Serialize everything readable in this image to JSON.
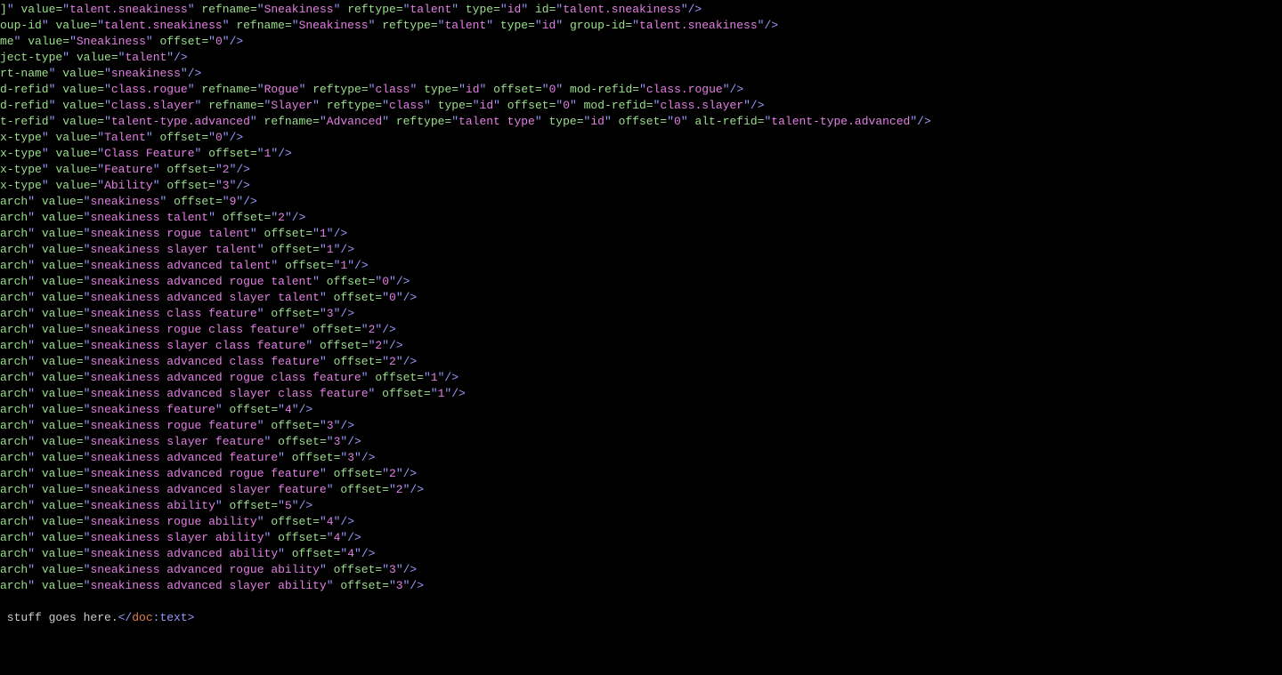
{
  "lines": [
    {
      "type": "xml",
      "pre": "",
      "attrs": [
        [
          "",
          "]",
          "",
          "talent.sneakiness"
        ],
        [
          "refname",
          "Sneakiness"
        ],
        [
          "reftype",
          "talent"
        ],
        [
          "type",
          "id"
        ],
        [
          "id",
          "talent.sneakiness"
        ]
      ]
    },
    {
      "type": "xml",
      "pre": "oup-id",
      "attrs": [
        [
          "value",
          "talent.sneakiness"
        ],
        [
          "refname",
          "Sneakiness"
        ],
        [
          "reftype",
          "talent"
        ],
        [
          "type",
          "id"
        ],
        [
          "group-id",
          "talent.sneakiness"
        ]
      ]
    },
    {
      "type": "xml",
      "pre": "me",
      "attrs": [
        [
          "value",
          "Sneakiness"
        ],
        [
          "offset",
          "0"
        ]
      ]
    },
    {
      "type": "xml",
      "pre": "ject-type",
      "attrs": [
        [
          "value",
          "talent"
        ]
      ]
    },
    {
      "type": "xml",
      "pre": "rt-name",
      "attrs": [
        [
          "value",
          "sneakiness"
        ]
      ]
    },
    {
      "type": "xml",
      "pre": "d-refid",
      "attrs": [
        [
          "value",
          "class.rogue"
        ],
        [
          "refname",
          "Rogue"
        ],
        [
          "reftype",
          "class"
        ],
        [
          "type",
          "id"
        ],
        [
          "offset",
          "0"
        ],
        [
          "mod-refid",
          "class.rogue"
        ]
      ]
    },
    {
      "type": "xml",
      "pre": "d-refid",
      "attrs": [
        [
          "value",
          "class.slayer"
        ],
        [
          "refname",
          "Slayer"
        ],
        [
          "reftype",
          "class"
        ],
        [
          "type",
          "id"
        ],
        [
          "offset",
          "0"
        ],
        [
          "mod-refid",
          "class.slayer"
        ]
      ]
    },
    {
      "type": "xml",
      "pre": "t-refid",
      "attrs": [
        [
          "value",
          "talent-type.advanced"
        ],
        [
          "refname",
          "Advanced"
        ],
        [
          "reftype",
          "talent type"
        ],
        [
          "type",
          "id"
        ],
        [
          "offset",
          "0"
        ],
        [
          "alt-refid",
          "talent-type.advanced"
        ]
      ]
    },
    {
      "type": "xml",
      "pre": "x-type",
      "attrs": [
        [
          "value",
          "Talent"
        ],
        [
          "offset",
          "0"
        ]
      ]
    },
    {
      "type": "xml",
      "pre": "x-type",
      "attrs": [
        [
          "value",
          "Class Feature"
        ],
        [
          "offset",
          "1"
        ]
      ]
    },
    {
      "type": "xml",
      "pre": "x-type",
      "attrs": [
        [
          "value",
          "Feature"
        ],
        [
          "offset",
          "2"
        ]
      ]
    },
    {
      "type": "xml",
      "pre": "x-type",
      "attrs": [
        [
          "value",
          "Ability"
        ],
        [
          "offset",
          "3"
        ]
      ]
    },
    {
      "type": "xml",
      "pre": "arch",
      "attrs": [
        [
          "value",
          "sneakiness"
        ],
        [
          "offset",
          "9"
        ]
      ]
    },
    {
      "type": "xml",
      "pre": "arch",
      "attrs": [
        [
          "value",
          "sneakiness talent"
        ],
        [
          "offset",
          "2"
        ]
      ]
    },
    {
      "type": "xml",
      "pre": "arch",
      "attrs": [
        [
          "value",
          "sneakiness rogue talent"
        ],
        [
          "offset",
          "1"
        ]
      ]
    },
    {
      "type": "xml",
      "pre": "arch",
      "attrs": [
        [
          "value",
          "sneakiness slayer talent"
        ],
        [
          "offset",
          "1"
        ]
      ]
    },
    {
      "type": "xml",
      "pre": "arch",
      "attrs": [
        [
          "value",
          "sneakiness advanced talent"
        ],
        [
          "offset",
          "1"
        ]
      ]
    },
    {
      "type": "xml",
      "pre": "arch",
      "attrs": [
        [
          "value",
          "sneakiness advanced rogue talent"
        ],
        [
          "offset",
          "0"
        ]
      ]
    },
    {
      "type": "xml",
      "pre": "arch",
      "attrs": [
        [
          "value",
          "sneakiness advanced slayer talent"
        ],
        [
          "offset",
          "0"
        ]
      ]
    },
    {
      "type": "xml",
      "pre": "arch",
      "attrs": [
        [
          "value",
          "sneakiness class feature"
        ],
        [
          "offset",
          "3"
        ]
      ]
    },
    {
      "type": "xml",
      "pre": "arch",
      "attrs": [
        [
          "value",
          "sneakiness rogue class feature"
        ],
        [
          "offset",
          "2"
        ]
      ]
    },
    {
      "type": "xml",
      "pre": "arch",
      "attrs": [
        [
          "value",
          "sneakiness slayer class feature"
        ],
        [
          "offset",
          "2"
        ]
      ]
    },
    {
      "type": "xml",
      "pre": "arch",
      "attrs": [
        [
          "value",
          "sneakiness advanced class feature"
        ],
        [
          "offset",
          "2"
        ]
      ]
    },
    {
      "type": "xml",
      "pre": "arch",
      "attrs": [
        [
          "value",
          "sneakiness advanced rogue class feature"
        ],
        [
          "offset",
          "1"
        ]
      ]
    },
    {
      "type": "xml",
      "pre": "arch",
      "attrs": [
        [
          "value",
          "sneakiness advanced slayer class feature"
        ],
        [
          "offset",
          "1"
        ]
      ]
    },
    {
      "type": "xml",
      "pre": "arch",
      "attrs": [
        [
          "value",
          "sneakiness feature"
        ],
        [
          "offset",
          "4"
        ]
      ]
    },
    {
      "type": "xml",
      "pre": "arch",
      "attrs": [
        [
          "value",
          "sneakiness rogue feature"
        ],
        [
          "offset",
          "3"
        ]
      ]
    },
    {
      "type": "xml",
      "pre": "arch",
      "attrs": [
        [
          "value",
          "sneakiness slayer feature"
        ],
        [
          "offset",
          "3"
        ]
      ]
    },
    {
      "type": "xml",
      "pre": "arch",
      "attrs": [
        [
          "value",
          "sneakiness advanced feature"
        ],
        [
          "offset",
          "3"
        ]
      ]
    },
    {
      "type": "xml",
      "pre": "arch",
      "attrs": [
        [
          "value",
          "sneakiness advanced rogue feature"
        ],
        [
          "offset",
          "2"
        ]
      ]
    },
    {
      "type": "xml",
      "pre": "arch",
      "attrs": [
        [
          "value",
          "sneakiness advanced slayer feature"
        ],
        [
          "offset",
          "2"
        ]
      ]
    },
    {
      "type": "xml",
      "pre": "arch",
      "attrs": [
        [
          "value",
          "sneakiness ability"
        ],
        [
          "offset",
          "5"
        ]
      ]
    },
    {
      "type": "xml",
      "pre": "arch",
      "attrs": [
        [
          "value",
          "sneakiness rogue ability"
        ],
        [
          "offset",
          "4"
        ]
      ]
    },
    {
      "type": "xml",
      "pre": "arch",
      "attrs": [
        [
          "value",
          "sneakiness slayer ability"
        ],
        [
          "offset",
          "4"
        ]
      ]
    },
    {
      "type": "xml",
      "pre": "arch",
      "attrs": [
        [
          "value",
          "sneakiness advanced ability"
        ],
        [
          "offset",
          "4"
        ]
      ]
    },
    {
      "type": "xml",
      "pre": "arch",
      "attrs": [
        [
          "value",
          "sneakiness advanced rogue ability"
        ],
        [
          "offset",
          "3"
        ]
      ]
    },
    {
      "type": "xml",
      "pre": "arch",
      "attrs": [
        [
          "value",
          "sneakiness advanced slayer ability"
        ],
        [
          "offset",
          "3"
        ]
      ]
    },
    {
      "type": "blank"
    },
    {
      "type": "footer",
      "text": " stuff goes here.",
      "ns": "doc",
      "el": "text"
    }
  ]
}
